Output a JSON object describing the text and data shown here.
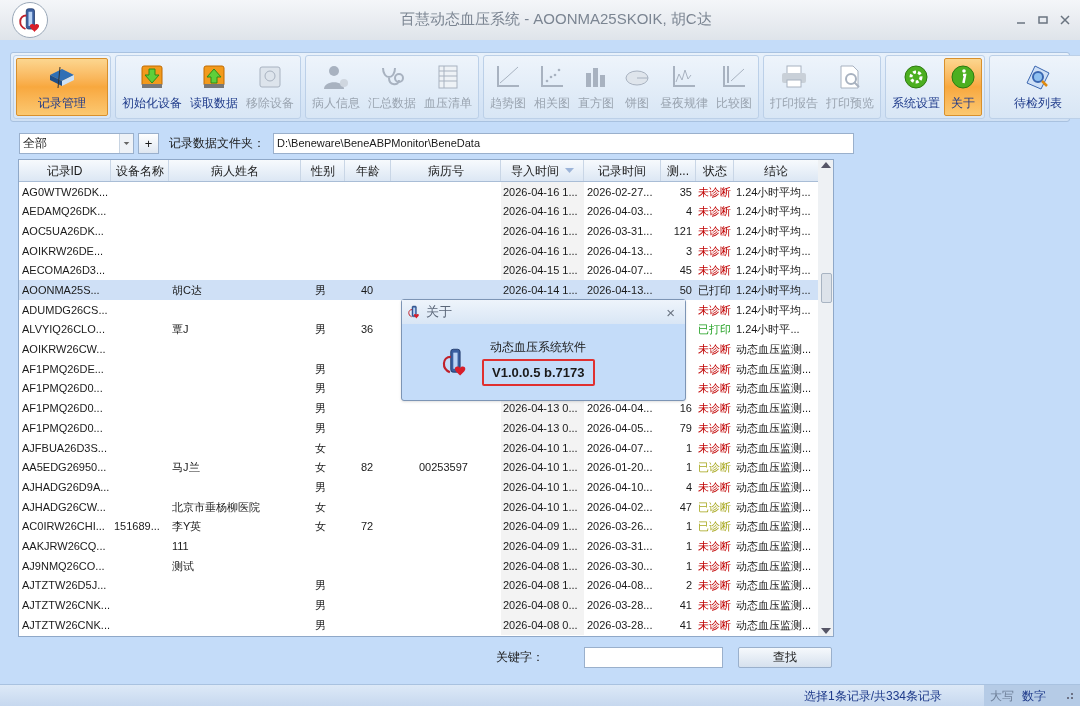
{
  "window": {
    "title": "百慧动态血压系统 - AOONMA25SKOIK, 胡C达"
  },
  "ribbon": [
    {
      "items": [
        {
          "label": "记录管理",
          "kind": "book",
          "disabled": false,
          "selected": true
        }
      ]
    },
    {
      "items": [
        {
          "label": "初始化设备",
          "kind": "down",
          "disabled": false,
          "selected": false
        },
        {
          "label": "读取数据",
          "kind": "up",
          "disabled": false,
          "selected": false
        },
        {
          "label": "移除设备",
          "kind": "remove",
          "disabled": true,
          "selected": false
        }
      ]
    },
    {
      "items": [
        {
          "label": "病人信息",
          "kind": "person",
          "disabled": true,
          "selected": false
        },
        {
          "label": "汇总数据",
          "kind": "stethoscope",
          "disabled": true,
          "selected": false
        },
        {
          "label": "血压清单",
          "kind": "list",
          "disabled": true,
          "selected": false
        }
      ]
    },
    {
      "items": [
        {
          "label": "趋势图",
          "kind": "trend",
          "disabled": true,
          "selected": false
        },
        {
          "label": "相关图",
          "kind": "scatter",
          "disabled": true,
          "selected": false
        },
        {
          "label": "直方图",
          "kind": "bars",
          "disabled": true,
          "selected": false
        },
        {
          "label": "饼图",
          "kind": "pie",
          "disabled": true,
          "selected": false
        },
        {
          "label": "昼夜规律",
          "kind": "wave",
          "disabled": true,
          "selected": false
        },
        {
          "label": "比较图",
          "kind": "compare",
          "disabled": true,
          "selected": false
        }
      ]
    },
    {
      "items": [
        {
          "label": "打印报告",
          "kind": "printer",
          "disabled": true,
          "selected": false
        },
        {
          "label": "打印预览",
          "kind": "preview",
          "disabled": true,
          "selected": false
        }
      ]
    },
    {
      "items": [
        {
          "label": "系统设置",
          "kind": "gear",
          "disabled": false,
          "selected": false
        },
        {
          "label": "关于",
          "kind": "info",
          "disabled": false,
          "selected": true
        }
      ]
    },
    {
      "items": [
        {
          "label": "待检列表",
          "kind": "magnifier",
          "disabled": false,
          "selected": false
        }
      ]
    }
  ],
  "filter": {
    "dropdown": "全部",
    "add_button": "+",
    "folder_label": "记录数据文件夹：",
    "folder_path": "D:\\Beneware\\BeneABPMonitor\\BeneData"
  },
  "table": {
    "columns": [
      {
        "label": "记录ID",
        "sorted": false
      },
      {
        "label": "设备名称",
        "sorted": false
      },
      {
        "label": "病人姓名",
        "sorted": false
      },
      {
        "label": "性别",
        "sorted": false
      },
      {
        "label": "年龄",
        "sorted": false
      },
      {
        "label": "病历号",
        "sorted": false
      },
      {
        "label": "导入时间",
        "sorted": true
      },
      {
        "label": "记录时间",
        "sorted": false
      },
      {
        "label": "测...",
        "sorted": false
      },
      {
        "label": "状态",
        "sorted": false
      },
      {
        "label": "结论",
        "sorted": false
      }
    ],
    "rows": [
      {
        "selected": false,
        "id": "AG0WTW26DK...",
        "import_time": "2026-04-16 1...",
        "record_time": "2026-02-27...",
        "count": "35",
        "status": {
          "text": "未诊断",
          "kind": "undiagnosed"
        },
        "conclusion": "1.24小时平均..."
      },
      {
        "selected": false,
        "id": "AEDAMQ26DK...",
        "import_time": "2026-04-16 1...",
        "record_time": "2026-04-03...",
        "count": "4",
        "status": {
          "text": "未诊断",
          "kind": "undiagnosed"
        },
        "conclusion": "1.24小时平均..."
      },
      {
        "selected": false,
        "id": "AOC5UA26DK...",
        "import_time": "2026-04-16 1...",
        "record_time": "2026-03-31...",
        "count": "121",
        "status": {
          "text": "未诊断",
          "kind": "undiagnosed"
        },
        "conclusion": "1.24小时平均..."
      },
      {
        "selected": false,
        "id": "AOIKRW26DE...",
        "import_time": "2026-04-16 1...",
        "record_time": "2026-04-13...",
        "count": "3",
        "status": {
          "text": "未诊断",
          "kind": "undiagnosed"
        },
        "conclusion": "1.24小时平均..."
      },
      {
        "selected": false,
        "id": "AECOMA26D3...",
        "import_time": "2026-04-15 1...",
        "record_time": "2026-04-07...",
        "count": "45",
        "status": {
          "text": "未诊断",
          "kind": "undiagnosed"
        },
        "conclusion": "1.24小时平均..."
      },
      {
        "selected": true,
        "id": "AOONMA25S...",
        "name": "胡C达",
        "sex": "男",
        "age": "40",
        "import_time": "2026-04-14 1...",
        "record_time": "2026-04-13...",
        "count": "50",
        "status": {
          "text": "已打印",
          "kind": "printed"
        },
        "conclusion": "1.24小时平均..."
      },
      {
        "selected": false,
        "id": "ADUMDG26CS...",
        "status": {
          "text": "未诊断",
          "kind": "undiagnosed"
        },
        "conclusion": "1.24小时平均..."
      },
      {
        "selected": false,
        "id": "ALVYIQ26CLO...",
        "name": "覃J",
        "sex": "男",
        "age": "36",
        "status": {
          "text": "已打印",
          "kind": "printed"
        },
        "conclusion": "1.24小时平..."
      },
      {
        "selected": false,
        "id": "AOIKRW26CW...",
        "status": {
          "text": "未诊断",
          "kind": "undiagnosed"
        },
        "conclusion": "动态血压监测..."
      },
      {
        "selected": false,
        "id": "AF1PMQ26DE...",
        "sex": "男",
        "status": {
          "text": "未诊断",
          "kind": "undiagnosed"
        },
        "conclusion": "动态血压监测..."
      },
      {
        "selected": false,
        "id": "AF1PMQ26D0...",
        "sex": "男",
        "status": {
          "text": "未诊断",
          "kind": "undiagnosed"
        },
        "conclusion": "动态血压监测..."
      },
      {
        "selected": false,
        "id": "AF1PMQ26D0...",
        "sex": "男",
        "import_time": "2026-04-13 0...",
        "record_time": "2026-04-04...",
        "count": "16",
        "status": {
          "text": "未诊断",
          "kind": "undiagnosed"
        },
        "conclusion": "动态血压监测..."
      },
      {
        "selected": false,
        "id": "AF1PMQ26D0...",
        "sex": "男",
        "import_time": "2026-04-13 0...",
        "record_time": "2026-04-05...",
        "count": "79",
        "status": {
          "text": "未诊断",
          "kind": "undiagnosed"
        },
        "conclusion": "动态血压监测..."
      },
      {
        "selected": false,
        "id": "AJFBUA26D3S...",
        "sex": "女",
        "import_time": "2026-04-10 1...",
        "record_time": "2026-04-07...",
        "count": "1",
        "status": {
          "text": "未诊断",
          "kind": "undiagnosed"
        },
        "conclusion": "动态血压监测..."
      },
      {
        "selected": false,
        "id": "AA5EDG26950...",
        "name": "马J兰",
        "sex": "女",
        "age": "82",
        "record_no": "00253597",
        "import_time": "2026-04-10 1...",
        "record_time": "2026-01-20...",
        "count": "1",
        "status": {
          "text": "已诊断",
          "kind": "diagnosed"
        },
        "conclusion": "动态血压监测..."
      },
      {
        "selected": false,
        "id": "AJHADG26D9A...",
        "sex": "男",
        "import_time": "2026-04-10 1...",
        "record_time": "2026-04-10...",
        "count": "4",
        "status": {
          "text": "未诊断",
          "kind": "undiagnosed"
        },
        "conclusion": "动态血压监测..."
      },
      {
        "selected": false,
        "id": "AJHADG26CW...",
        "name": "北京市垂杨柳医院",
        "sex": "女",
        "import_time": "2026-04-10 1...",
        "record_time": "2026-04-02...",
        "count": "47",
        "status": {
          "text": "已诊断",
          "kind": "diagnosed"
        },
        "conclusion": "动态血压监测..."
      },
      {
        "selected": false,
        "id": "AC0IRW26CHI...",
        "device": "151689...",
        "name": "李Y英",
        "sex": "女",
        "age": "72",
        "import_time": "2026-04-09 1...",
        "record_time": "2026-03-26...",
        "count": "1",
        "status": {
          "text": "已诊断",
          "kind": "diagnosed"
        },
        "conclusion": "动态血压监测..."
      },
      {
        "selected": false,
        "id": "AAKJRW26CQ...",
        "name": "111",
        "import_time": "2026-04-09 1...",
        "record_time": "2026-03-31...",
        "count": "1",
        "status": {
          "text": "未诊断",
          "kind": "undiagnosed"
        },
        "conclusion": "动态血压监测..."
      },
      {
        "selected": false,
        "id": "AJ9NMQ26CO...",
        "name": "测试",
        "import_time": "2026-04-08 1...",
        "record_time": "2026-03-30...",
        "count": "1",
        "status": {
          "text": "未诊断",
          "kind": "undiagnosed"
        },
        "conclusion": "动态血压监测..."
      },
      {
        "selected": false,
        "id": "AJTZTW26D5J...",
        "sex": "男",
        "import_time": "2026-04-08 1...",
        "record_time": "2026-04-08...",
        "count": "2",
        "status": {
          "text": "未诊断",
          "kind": "undiagnosed"
        },
        "conclusion": "动态血压监测..."
      },
      {
        "selected": false,
        "id": "AJTZTW26CNK...",
        "sex": "男",
        "import_time": "2026-04-08 0...",
        "record_time": "2026-03-28...",
        "count": "41",
        "status": {
          "text": "未诊断",
          "kind": "undiagnosed"
        },
        "conclusion": "动态血压监测..."
      },
      {
        "selected": false,
        "id": "AJTZTW26CNK...",
        "sex": "男",
        "import_time": "2026-04-08 0...",
        "record_time": "2026-03-28...",
        "count": "41",
        "status": {
          "text": "未诊断",
          "kind": "undiagnosed"
        },
        "conclusion": "动态血压监测..."
      }
    ]
  },
  "search": {
    "label": "关键字：",
    "button": "查找"
  },
  "status_bar": {
    "message": "选择1条记录/共334条记录",
    "caps": {
      "label": "大写",
      "on": false
    },
    "num": {
      "label": "数字",
      "on": true
    }
  },
  "dialog": {
    "title": "关于",
    "close": "×",
    "product": "动态血压系统软件",
    "version": "V1.0.0.5 b.7173"
  }
}
